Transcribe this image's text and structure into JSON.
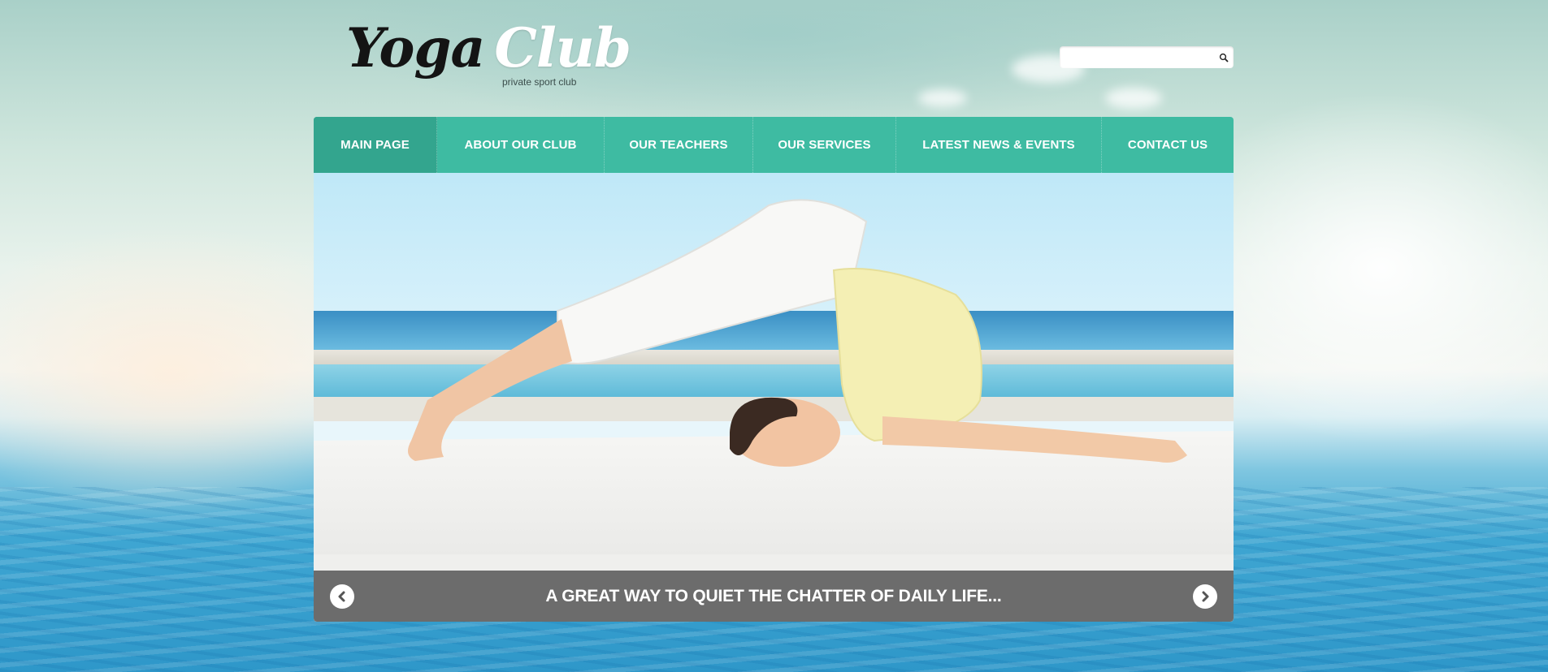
{
  "logo": {
    "word1": "Yoga",
    "word2": "Club",
    "tagline": "private sport club"
  },
  "search": {
    "value": "",
    "icon": "search-icon"
  },
  "nav": {
    "items": [
      {
        "label": "MAIN PAGE",
        "active": true
      },
      {
        "label": "ABOUT OUR CLUB",
        "active": false
      },
      {
        "label": "OUR TEACHERS",
        "active": false
      },
      {
        "label": "OUR SERVICES",
        "active": false
      },
      {
        "label": "LATEST NEWS & EVENTS",
        "active": false
      },
      {
        "label": "CONTACT US",
        "active": false
      }
    ]
  },
  "slider": {
    "caption": "A GREAT WAY TO QUIET THE CHATTER OF DAILY LIFE...",
    "prev_icon": "chevron-left-icon",
    "next_icon": "chevron-right-icon"
  },
  "colors": {
    "nav_bg": "#3ebba2",
    "nav_active": "#33a58e",
    "caption_bar": "#5a5a5a",
    "logo_dark": "#141414"
  }
}
